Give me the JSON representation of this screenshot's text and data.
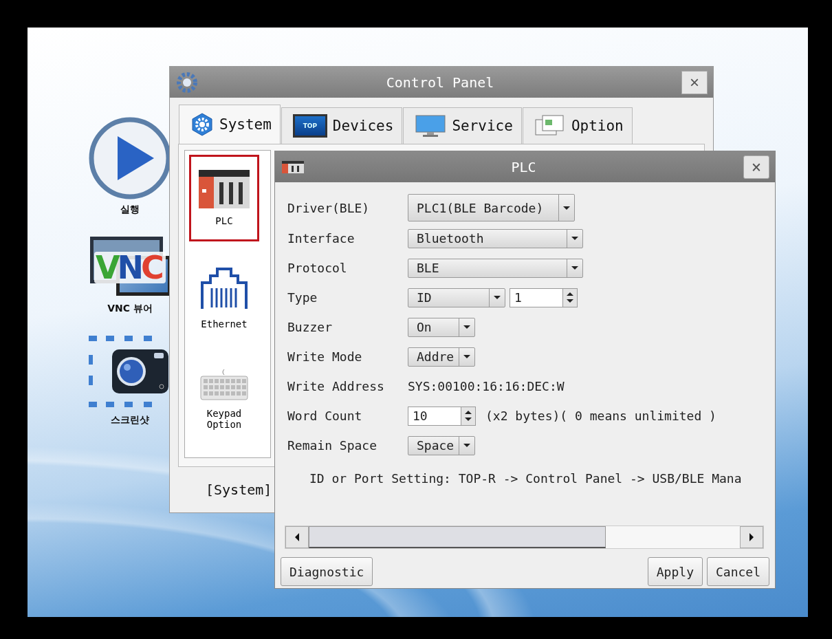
{
  "desktop_icons": [
    {
      "label": "실행"
    },
    {
      "label": "VNC 뷰어",
      "logo_text": "VNC"
    },
    {
      "label": "스크린샷"
    }
  ],
  "control_panel": {
    "title": "Control Panel",
    "close": "×",
    "tabs": [
      {
        "label": "System",
        "selected": true
      },
      {
        "label": "Devices",
        "selected": false,
        "icon_text": "TOP"
      },
      {
        "label": "Service",
        "selected": false
      },
      {
        "label": "Option",
        "selected": false
      }
    ],
    "items": [
      {
        "label": "PLC",
        "selected": true
      },
      {
        "label": "Ethernet",
        "selected": false
      },
      {
        "label": "Keypad Option",
        "selected": false
      }
    ],
    "status": "[System]"
  },
  "plc_dialog": {
    "title": "PLC",
    "close": "×",
    "fields": [
      {
        "kind": "dropdown",
        "label": "Driver(BLE)",
        "value": "PLC1(BLE Barcode)"
      },
      {
        "kind": "dropdown",
        "label": "Interface",
        "value": "Bluetooth"
      },
      {
        "kind": "dropdown",
        "label": "Protocol",
        "value": "BLE"
      },
      {
        "kind": "dropdown_spin",
        "label": "Type",
        "value": "ID",
        "spin_value": "1"
      },
      {
        "kind": "dropdown",
        "label": "Buzzer",
        "value": "On"
      },
      {
        "kind": "dropdown",
        "label": "Write Mode",
        "value": "Addre"
      },
      {
        "kind": "text",
        "label": "Write Address",
        "value": "SYS:00100:16:16:DEC:W"
      },
      {
        "kind": "spin",
        "label": "Word Count",
        "value": "10",
        "note": "(x2 bytes)( 0 means unlimited )"
      },
      {
        "kind": "dropdown",
        "label": "Remain Space",
        "value": "Space"
      }
    ],
    "note": "ID or Port Setting: TOP-R -> Control Panel -> USB/BLE Mana",
    "buttons": [
      {
        "label": "Diagnostic"
      },
      {
        "label": "Apply"
      },
      {
        "label": "Cancel"
      }
    ]
  }
}
